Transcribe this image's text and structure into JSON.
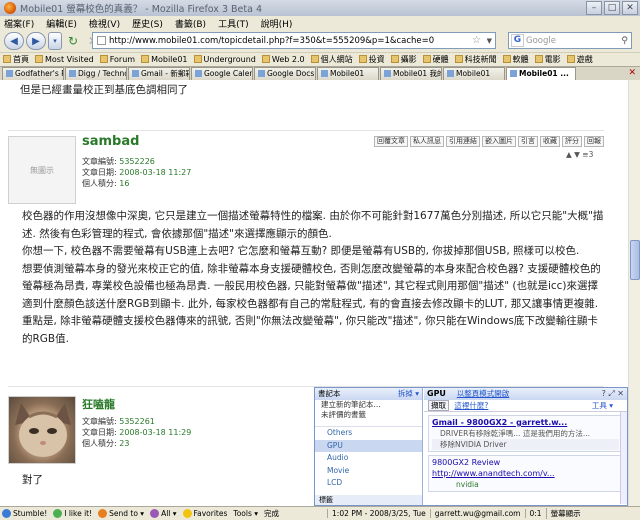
{
  "window": {
    "title": "Mobile01 螢幕校色的真義？ - Mozilla Firefox 3 Beta 4"
  },
  "menu": [
    "檔案(F)",
    "編輯(E)",
    "檢視(V)",
    "歷史(S)",
    "書籤(B)",
    "工具(T)",
    "說明(H)"
  ],
  "nav": {
    "url": "http://www.mobile01.com/topicdetail.php?f=350&t=555209&p=1&cache=0",
    "search_placeholder": "Google"
  },
  "bookmarks": [
    "首頁",
    "Most Visited",
    "Forum",
    "Mobile01",
    "Underground",
    "Web 2.0",
    "個人網站",
    "投資",
    "攝影",
    "硬體",
    "科技新聞",
    "軟體",
    "電影",
    "遊戲"
  ],
  "tabs": [
    {
      "label": "Godfather's Per..."
    },
    {
      "label": "Digg / Technolo..."
    },
    {
      "label": "Gmail - 新郵箱 -..."
    },
    {
      "label": "Google Calendar"
    },
    {
      "label": "Google Docs - F..."
    },
    {
      "label": "Mobile01"
    },
    {
      "label": "Mobile01 我的..."
    },
    {
      "label": "Mobile01"
    },
    {
      "label": "Mobile01 ..."
    }
  ],
  "content": {
    "prev_text": "但是已經畫量校正到基底色調相同了",
    "post1": {
      "avatar_label": "無圖示",
      "author": "sambad",
      "number_label": "文章編號:",
      "number": "5352226",
      "date_label": "文章日期:",
      "date": "2008-03-18 11:27",
      "points_label": "個人積分:",
      "points": "16",
      "actions": [
        "回覆文章",
        "私人訊息",
        "引用連結",
        "嵌入圖片",
        "引言",
        "收藏",
        "評分",
        "回報"
      ],
      "votes": "▲ ▼ ≡3",
      "paragraphs": [
        "校色器的作用沒想像中深奧, 它只是建立一個描述螢幕特性的檔案. 由於你不可能針對1677萬色分別描述, 所以它只能\"大概\"描述. 然後有色彩管理的程式, 會依據那個\"描述\"來選擇應顯示的顏色.",
        "你想一下, 校色器不需要螢幕有USB連上去吧? 它怎麼和螢幕互動? 即便是螢幕有USB的, 你拔掉那個USB, 照樣可以校色.",
        "想要偵測螢幕本身的發光來校正它的值, 除非螢幕本身支援硬體校色, 否則怎麼改變螢幕的本身來配合校色器? 支援硬體校色的螢幕極為昂貴, 專業校色設備也極為昂貴. 一般民用校色器, 只能對螢幕做\"描述\", 其它程式則用那個\"描述\" (也就是icc)來選擇適到什麼顏色該送什麼RGB到顯卡. 此外, 每家校色器都有自己的常駐程式, 有的會直接去修改顯卡的LUT, 那又讓事情更複雜.",
        "重點是, 除非螢幕硬體支援校色器傳來的訊號, 否則\"你無法改變螢幕\", 你只能改\"描述\", 你只能在Windows底下改變輸往顯卡的RGB值."
      ]
    },
    "post2": {
      "author": "狂嗑龍",
      "number_label": "文章編號:",
      "number": "5352261",
      "date_label": "文章日期:",
      "date": "2008-03-18 11:29",
      "points_label": "個人積分:",
      "points": "23",
      "text": "對了"
    }
  },
  "sidebar": {
    "left": {
      "header": "書記本",
      "header_action": "拆掉 ▾",
      "rows": [
        "建立新的筆記本...",
        "未評價的書籤"
      ],
      "list": [
        "Others",
        "GPU",
        "Audio",
        "Movie",
        "LCD"
      ],
      "selected": "GPU",
      "footer": "標籤"
    },
    "right": {
      "title": "GPU",
      "title_link": "以整頁模式開啟",
      "controls": "? ⤢ ✕",
      "toolbar_button": "擷取",
      "toolbar_link": "這裡什麼?",
      "tools_label": "工具 ▾",
      "results": [
        {
          "title": "Gmail - 9800GX2 - garrett.w...",
          "snippet": "DRIVER有移除乾淨嗎... 這是我們用的方法...",
          "tag": "移除NVIDIA Driver"
        },
        {
          "title": "9800GX2 Review",
          "link": "http://www.anandtech.com/v...",
          "tag": "nvidia"
        }
      ]
    }
  },
  "status": {
    "items": [
      "Stumble!",
      "I like it!",
      "Send to ▾",
      "All ▾",
      "Favorites",
      "Tools ▾",
      "完成"
    ],
    "time": "1:02 PM - 2008/3/25, Tue",
    "email": "garrett.wu@gmail.com",
    "count": "0:1",
    "right": "螢幕顯示"
  }
}
